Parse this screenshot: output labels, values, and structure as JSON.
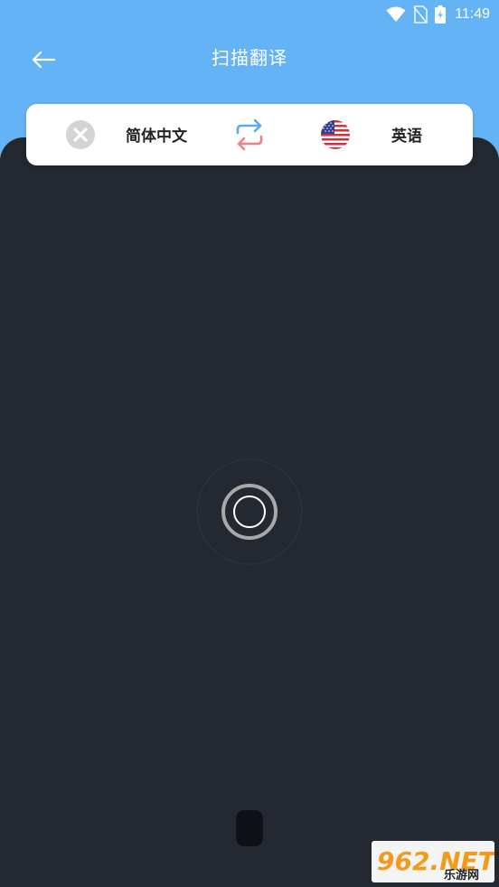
{
  "status_bar": {
    "time": "11:49",
    "icons": [
      "wifi-icon",
      "no-sim-icon",
      "battery-charging-icon"
    ]
  },
  "header": {
    "title": "扫描翻译",
    "back_icon": "back-arrow-icon"
  },
  "language_bar": {
    "source_language": "简体中文",
    "source_flag_icon": "chinese-flag-placeholder-icon",
    "swap_icon": "swap-arrows-icon",
    "target_language": "英语",
    "target_flag_icon": "us-flag-icon"
  },
  "camera": {
    "focus_icon": "focus-ring-icon",
    "shutter_icon": "shutter-button"
  },
  "watermark": {
    "brand": "962.NET",
    "brand_sub": "乐游网"
  },
  "colors": {
    "header_bg": "#64b3f4",
    "camera_bg": "#232831",
    "swap_top": "#5aa9ec",
    "swap_bottom": "#f07f85"
  }
}
